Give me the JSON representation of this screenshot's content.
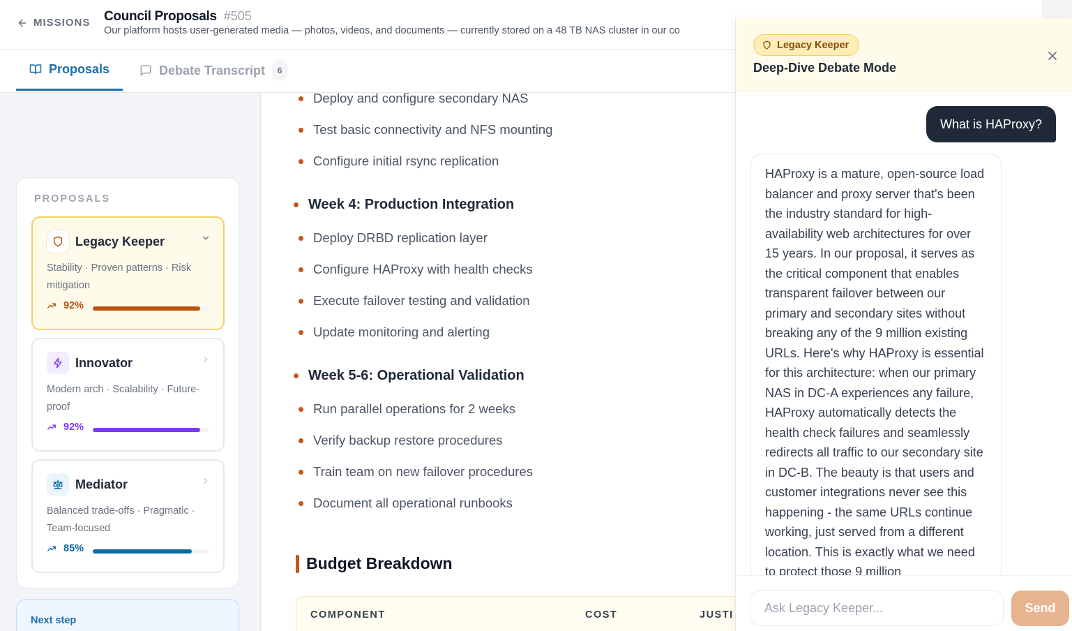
{
  "header": {
    "back_label": "MISSIONS",
    "title": "Council Proposals",
    "id": "#505",
    "subtitle": "Our platform hosts user-generated media — photos, videos, and documents — currently stored on a 48 TB NAS cluster in our co"
  },
  "tabs": [
    {
      "label": "Proposals",
      "icon": "book-open-icon"
    },
    {
      "label": "Debate Transcript",
      "icon": "message-square-icon",
      "count": "6"
    }
  ],
  "sidebar": {
    "heading": "PROPOSALS",
    "cards": [
      {
        "name": "Legacy Keeper",
        "desc": "Stability · Proven patterns · Risk mitigation",
        "score": "92%",
        "score_value": 0.92,
        "color": "#b8540f",
        "icon": "shield-icon",
        "icon_bg": "#ffffff"
      },
      {
        "name": "Innovator",
        "desc": "Modern arch · Scalability · Future-proof",
        "score": "92%",
        "score_value": 0.92,
        "color": "#7c3aed",
        "icon": "zap-icon",
        "icon_bg": "#f3eefe"
      },
      {
        "name": "Mediator",
        "desc": "Balanced trade-offs · Pragmatic · Team-focused",
        "score": "85%",
        "score_value": 0.85,
        "color": "#0e6aa6",
        "icon": "scale-icon",
        "icon_bg": "#eaf4fb"
      }
    ],
    "next_step": "Next step"
  },
  "main": {
    "bullets_top": [
      "Deploy and configure secondary NAS",
      "Test basic connectivity and NFS mounting",
      "Configure initial rsync replication"
    ],
    "week4": {
      "title": "Week 4: Production Integration",
      "items": [
        "Deploy DRBD replication layer",
        "Configure HAProxy with health checks",
        "Execute failover testing and validation",
        "Update monitoring and alerting"
      ]
    },
    "week56": {
      "title": "Week 5-6: Operational Validation",
      "items": [
        "Run parallel operations for 2 weeks",
        "Verify backup restore procedures",
        "Train team on new failover procedures",
        "Document all operational runbooks"
      ]
    },
    "budget": {
      "title": "Budget Breakdown",
      "columns": [
        "COMPONENT",
        "COST",
        "JUSTI"
      ]
    }
  },
  "debate": {
    "badge": "Legacy Keeper",
    "title": "Deep-Dive Debate Mode",
    "user_message": "What is HAProxy?",
    "ai_message": "HAProxy is a mature, open-source load balancer and proxy server that's been the industry standard for high-availability web architectures for over 15 years. In our proposal, it serves as the critical component that enables transparent failover between our primary and secondary sites without breaking any of the 9 million existing URLs. Here's why HAProxy is essential for this architecture: when our primary NAS in DC-A experiences any failure, HAProxy automatically detects the health check failures and seamlessly redirects all traffic to our secondary site in DC-B. The beauty is that users and customer integrations never see this happening - the same URLs continue working, just served from a different location. This is exactly what we need to protect those 9 million",
    "input_placeholder": "Ask Legacy Keeper...",
    "send_label": "Send"
  }
}
